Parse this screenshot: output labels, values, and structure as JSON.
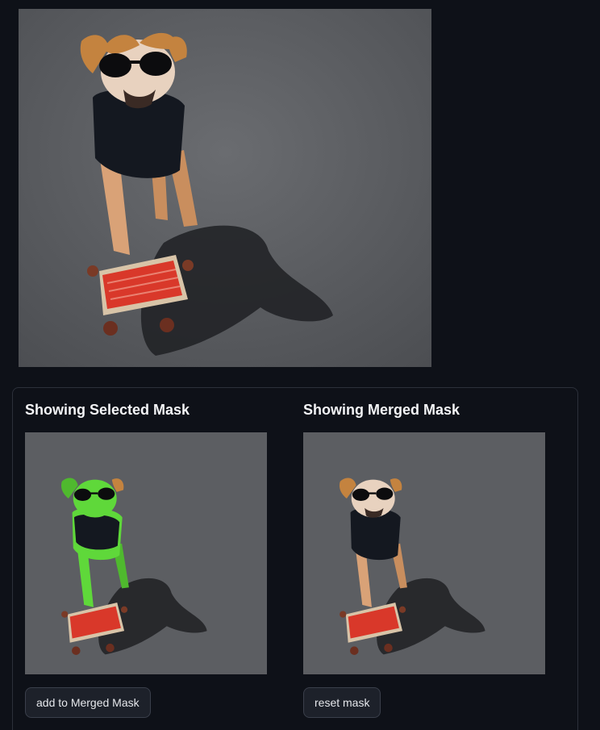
{
  "panels": {
    "selected": {
      "title": "Showing Selected Mask",
      "button_label": "add to Merged Mask"
    },
    "merged": {
      "title": "Showing Merged Mask",
      "button_label": "reset mask"
    }
  },
  "colors": {
    "background": "#0e1118",
    "panel_border": "#2c303a",
    "button_bg": "#1d212a",
    "mask_overlay": "#5fd83a",
    "asphalt": "#5c5e62",
    "skateboard_deck": "#e0402e"
  }
}
